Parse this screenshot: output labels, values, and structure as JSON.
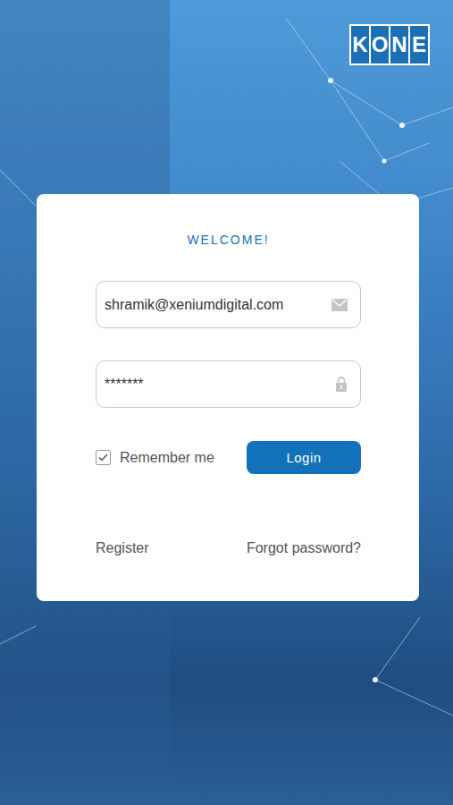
{
  "logo": "KONE",
  "card": {
    "title": "WELCOME!",
    "email": {
      "value": "shramik@xeniumdigital.com"
    },
    "password": {
      "value": "*******"
    },
    "remember": {
      "label": "Remember me",
      "checked": true
    },
    "login_button": "Login",
    "links": [
      {
        "label": "Register"
      },
      {
        "label": "Forgot password?"
      }
    ]
  }
}
